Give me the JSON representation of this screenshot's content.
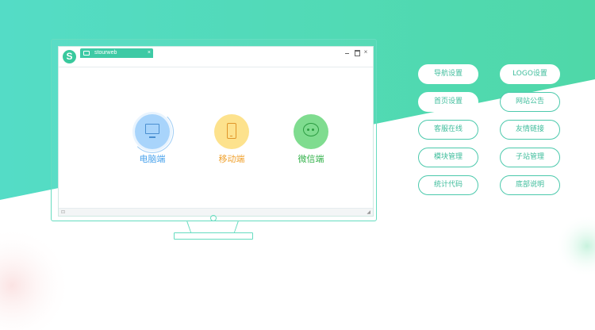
{
  "window": {
    "logo_letter": "S",
    "tab_label": "stourweb",
    "tab_close": "×",
    "close_glyph": "×"
  },
  "clients": [
    {
      "label": "电脑端",
      "icon": "desktop-icon",
      "color": "#4aa3ec"
    },
    {
      "label": "移动端",
      "icon": "mobile-phone-icon",
      "color": "#f0a22f"
    },
    {
      "label": "微信端",
      "icon": "wechat-icon",
      "color": "#34b24b"
    }
  ],
  "statusbar": {
    "left_glyph": "⊡",
    "right_glyph": "◢"
  },
  "menu": [
    {
      "label": "导航设置"
    },
    {
      "label": "LOGO设置"
    },
    {
      "label": "首页设置"
    },
    {
      "label": "网站公告"
    },
    {
      "label": "客服在线"
    },
    {
      "label": "友情链接"
    },
    {
      "label": "模块管理"
    },
    {
      "label": "子站管理"
    },
    {
      "label": "统计代码"
    },
    {
      "label": "底部说明"
    }
  ],
  "colors": {
    "accent": "#4cd3ad",
    "button_text": "#3fbd9c"
  }
}
